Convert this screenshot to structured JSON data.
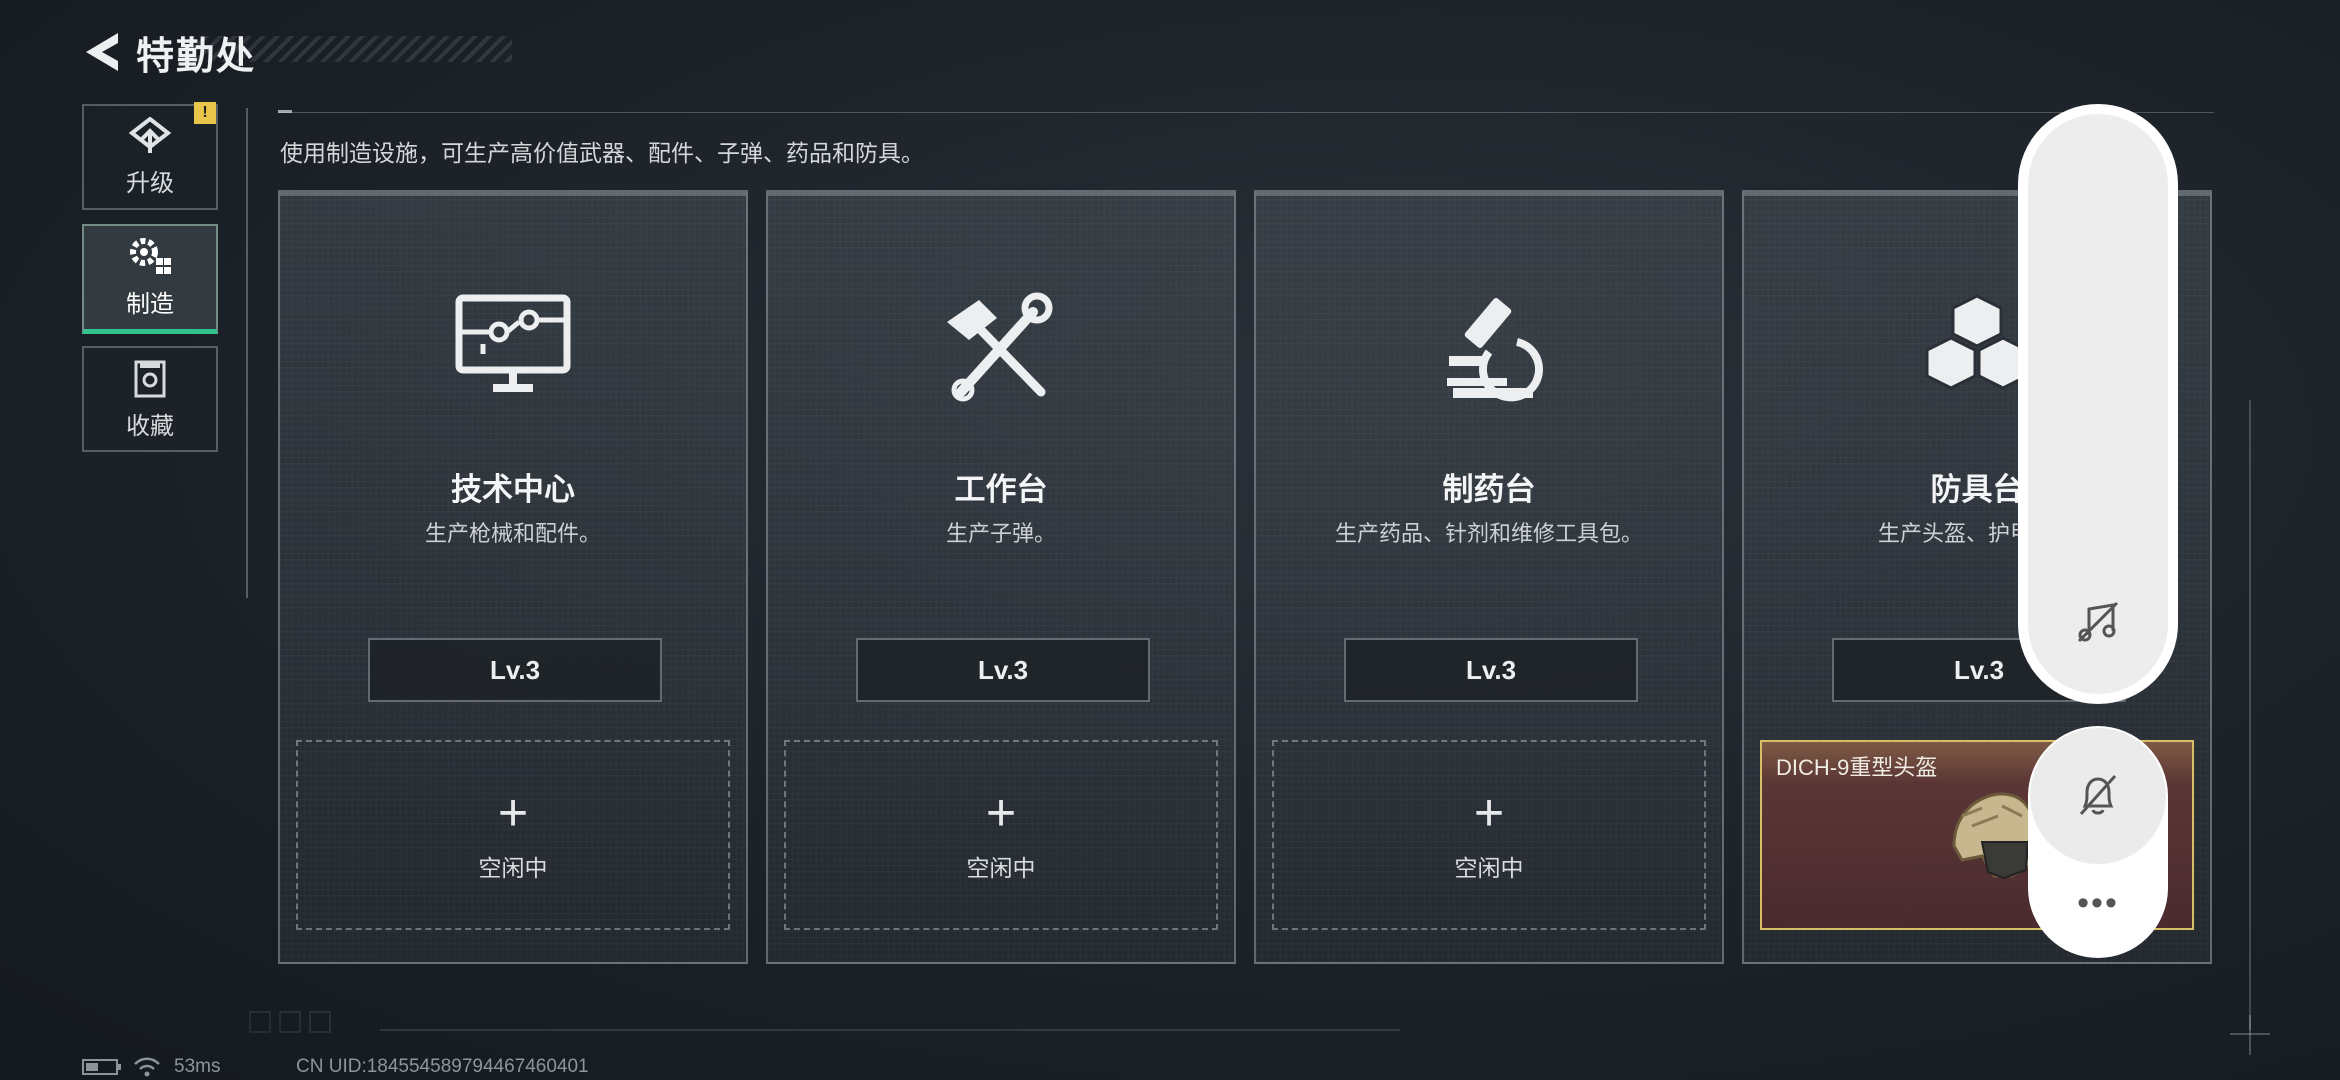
{
  "header": {
    "title": "特勤处"
  },
  "sidebar": {
    "items": [
      {
        "label": "升级",
        "icon": "upgrade-icon",
        "badge": "!"
      },
      {
        "label": "制造",
        "icon": "craft-gear-icon",
        "active": true
      },
      {
        "label": "收藏",
        "icon": "collection-icon"
      }
    ]
  },
  "description": "使用制造设施，可生产高价值武器、配件、子弹、药品和防具。",
  "cards": [
    {
      "name": "技术中心",
      "sub": "生产枪械和配件。",
      "level": "Lv.3",
      "icon": "monitor-circuit-icon",
      "slot": {
        "plus": "+",
        "status": "空闲中"
      }
    },
    {
      "name": "工作台",
      "sub": "生产子弹。",
      "level": "Lv.3",
      "icon": "hammer-wrench-icon",
      "slot": {
        "plus": "+",
        "status": "空闲中"
      }
    },
    {
      "name": "制药台",
      "sub": "生产药品、针剂和维修工具包。",
      "level": "Lv.3",
      "icon": "microscope-icon",
      "slot": {
        "plus": "+",
        "status": "空闲中"
      }
    },
    {
      "name": "防具台",
      "sub": "生产头盔、护甲、胸",
      "level": "Lv.3",
      "icon": "armor-boxes-icon",
      "slot": {
        "item_name": "DICH-9重型头盔",
        "item_icon": "helmet-icon"
      }
    }
  ],
  "overlay": {
    "more": "•••"
  },
  "status_bar": {
    "ping": "53ms",
    "uid": "CN UID:184554589794467460401"
  },
  "colors": {
    "active_tab": "#34c38f",
    "badge": "#e8c64a",
    "busy_border": "#d7bd63"
  }
}
